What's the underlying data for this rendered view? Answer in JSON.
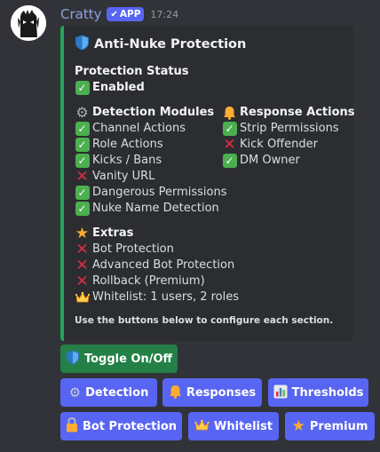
{
  "message": {
    "username": "Cratty",
    "badge": "APP",
    "timestamp": "17:24"
  },
  "embed": {
    "title": "Anti-Nuke Protection",
    "accent_color": "#23a559",
    "status_heading": "Protection Status",
    "status_value": "Enabled",
    "detection": {
      "heading": "Detection Modules",
      "items": [
        {
          "label": "Channel Actions",
          "enabled": true
        },
        {
          "label": "Role Actions",
          "enabled": true
        },
        {
          "label": "Kicks / Bans",
          "enabled": true
        },
        {
          "label": "Vanity URL",
          "enabled": false
        },
        {
          "label": "Dangerous Permissions",
          "enabled": true
        },
        {
          "label": "Nuke Name Detection",
          "enabled": true
        }
      ]
    },
    "responses": {
      "heading": "Response Actions",
      "items": [
        {
          "label": "Strip Permissions",
          "enabled": true
        },
        {
          "label": "Kick Offender",
          "enabled": false
        },
        {
          "label": "DM Owner",
          "enabled": true
        }
      ]
    },
    "extras": {
      "heading": "Extras",
      "items": [
        {
          "label": "Bot Protection",
          "icon": "cross-icon"
        },
        {
          "label": "Advanced Bot Protection",
          "icon": "cross-icon"
        },
        {
          "label": "Rollback (Premium)",
          "icon": "cross-icon"
        },
        {
          "label": "Whitelist: 1 users, 2 roles",
          "icon": "crown-icon"
        }
      ]
    },
    "footer": "Use the buttons below to configure each section."
  },
  "buttons": {
    "toggle": "Toggle On/Off",
    "detection": "Detection",
    "responses": "Responses",
    "thresholds": "Thresholds",
    "bot_protection": "Bot Protection",
    "whitelist": "Whitelist",
    "premium": "Premium"
  },
  "colors": {
    "blurple": "#5865f2",
    "green": "#248046",
    "check_green": "#4caf50",
    "cross_red": "#dd2e44"
  }
}
